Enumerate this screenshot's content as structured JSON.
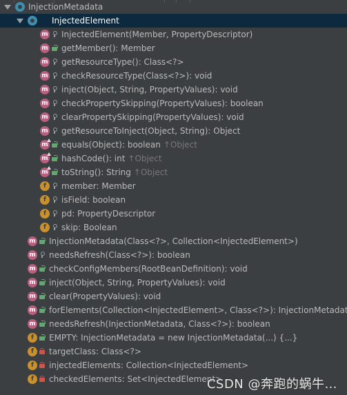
{
  "tree": {
    "rows": [
      {
        "text": "InjectionMetadata",
        "inherit": "",
        "kind": "class-root",
        "vis": "",
        "indent": 0,
        "arrow": true,
        "selected": false,
        "over": false
      },
      {
        "text": "InjectedElement",
        "inherit": "",
        "kind": "class",
        "vis": "",
        "indent": 1,
        "arrow": true,
        "selected": true,
        "over": false
      },
      {
        "text": "InjectedElement(Member, PropertyDescriptor)",
        "inherit": "",
        "kind": "m",
        "vis": "package",
        "indent": 2,
        "arrow": false,
        "selected": false,
        "over": false
      },
      {
        "text": "getMember(): Member",
        "inherit": "",
        "kind": "m",
        "vis": "public",
        "indent": 2,
        "arrow": false,
        "selected": false,
        "over": false
      },
      {
        "text": "getResourceType(): Class<?>",
        "inherit": "",
        "kind": "m",
        "vis": "package",
        "indent": 2,
        "arrow": false,
        "selected": false,
        "over": false
      },
      {
        "text": "checkResourceType(Class<?>): void",
        "inherit": "",
        "kind": "m",
        "vis": "package",
        "indent": 2,
        "arrow": false,
        "selected": false,
        "over": false
      },
      {
        "text": "inject(Object, String, PropertyValues): void",
        "inherit": "",
        "kind": "m",
        "vis": "package",
        "indent": 2,
        "arrow": false,
        "selected": false,
        "over": false
      },
      {
        "text": "checkPropertySkipping(PropertyValues): boolean",
        "inherit": "",
        "kind": "m",
        "vis": "package",
        "indent": 2,
        "arrow": false,
        "selected": false,
        "over": false
      },
      {
        "text": "clearPropertySkipping(PropertyValues): void",
        "inherit": "",
        "kind": "m",
        "vis": "package",
        "indent": 2,
        "arrow": false,
        "selected": false,
        "over": false
      },
      {
        "text": "getResourceToInject(Object, String): Object",
        "inherit": "",
        "kind": "m",
        "vis": "package",
        "indent": 2,
        "arrow": false,
        "selected": false,
        "over": false
      },
      {
        "text": "equals(Object): boolean",
        "inherit": "↑Object",
        "kind": "m",
        "vis": "public",
        "indent": 2,
        "arrow": false,
        "selected": false,
        "over": true
      },
      {
        "text": "hashCode(): int",
        "inherit": "↑Object",
        "kind": "m",
        "vis": "public",
        "indent": 2,
        "arrow": false,
        "selected": false,
        "over": true
      },
      {
        "text": "toString(): String",
        "inherit": "↑Object",
        "kind": "m",
        "vis": "public",
        "indent": 2,
        "arrow": false,
        "selected": false,
        "over": true
      },
      {
        "text": "member: Member",
        "inherit": "",
        "kind": "f",
        "vis": "package",
        "indent": 2,
        "arrow": false,
        "selected": false,
        "over": false
      },
      {
        "text": "isField: boolean",
        "inherit": "",
        "kind": "f",
        "vis": "package",
        "indent": 2,
        "arrow": false,
        "selected": false,
        "over": false
      },
      {
        "text": "pd: PropertyDescriptor",
        "inherit": "",
        "kind": "f",
        "vis": "package",
        "indent": 2,
        "arrow": false,
        "selected": false,
        "over": false
      },
      {
        "text": "skip: Boolean",
        "inherit": "",
        "kind": "f",
        "vis": "package",
        "indent": 2,
        "arrow": false,
        "selected": false,
        "over": false
      },
      {
        "text": "InjectionMetadata(Class<?>, Collection<InjectedElement>)",
        "inherit": "",
        "kind": "m",
        "vis": "public",
        "indent": 1,
        "arrow": false,
        "selected": false,
        "over": false
      },
      {
        "text": "needsRefresh(Class<?>): boolean",
        "inherit": "",
        "kind": "m",
        "vis": "package",
        "indent": 1,
        "arrow": false,
        "selected": false,
        "over": false
      },
      {
        "text": "checkConfigMembers(RootBeanDefinition): void",
        "inherit": "",
        "kind": "m",
        "vis": "public",
        "indent": 1,
        "arrow": false,
        "selected": false,
        "over": false
      },
      {
        "text": "inject(Object, String, PropertyValues): void",
        "inherit": "",
        "kind": "m",
        "vis": "public",
        "indent": 1,
        "arrow": false,
        "selected": false,
        "over": false
      },
      {
        "text": "clear(PropertyValues): void",
        "inherit": "",
        "kind": "m",
        "vis": "public",
        "indent": 1,
        "arrow": false,
        "selected": false,
        "over": false
      },
      {
        "text": "forElements(Collection<InjectedElement>, Class<?>): InjectionMetadata",
        "inherit": "",
        "kind": "m",
        "vis": "public",
        "indent": 1,
        "arrow": false,
        "selected": false,
        "over": false
      },
      {
        "text": "needsRefresh(InjectionMetadata, Class<?>): boolean",
        "inherit": "",
        "kind": "m",
        "vis": "public",
        "indent": 1,
        "arrow": false,
        "selected": false,
        "over": false
      },
      {
        "text": "EMPTY: InjectionMetadata = new InjectionMetadata(...) {...}",
        "inherit": "",
        "kind": "f",
        "vis": "public",
        "indent": 1,
        "arrow": false,
        "selected": false,
        "over": false
      },
      {
        "text": "targetClass: Class<?>",
        "inherit": "",
        "kind": "f",
        "vis": "private",
        "indent": 1,
        "arrow": false,
        "selected": false,
        "over": false
      },
      {
        "text": "injectedElements: Collection<InjectedElement>",
        "inherit": "",
        "kind": "f",
        "vis": "private",
        "indent": 1,
        "arrow": false,
        "selected": false,
        "over": false
      },
      {
        "text": "checkedElements: Set<InjectedElement>",
        "inherit": "",
        "kind": "f",
        "vis": "private",
        "indent": 1,
        "arrow": false,
        "selected": false,
        "over": false
      }
    ]
  },
  "watermark": "CSDN @奔跑的蜗牛…",
  "colors": {
    "background": "#3c3f41",
    "selection": "#0d293e",
    "method_icon": "#b75f7d",
    "field_icon": "#c9902e",
    "class_icon": "#3f8fb0",
    "public": "#62a86f",
    "private": "#d2534a"
  }
}
